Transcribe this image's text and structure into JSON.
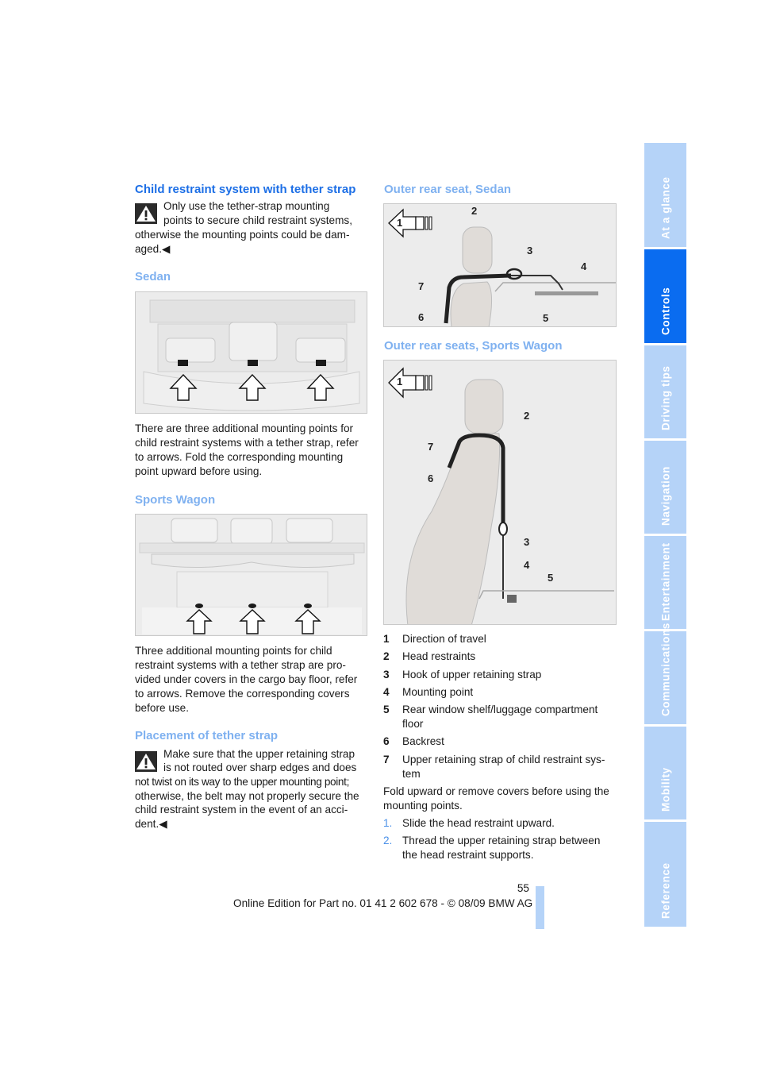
{
  "left_column": {
    "title": "Child restraint system with tether strap",
    "warning1_line1": "Only use the tether-strap mounting",
    "warning1_line2": "points to secure child restraint systems,",
    "warning1_line3": "otherwise the mounting points could be dam-",
    "warning1_line4": "aged.◀",
    "sedan_heading": "Sedan",
    "sedan_text": [
      "There are three additional mounting points for",
      "child restraint systems with a tether strap, refer",
      "to arrows. Fold the corresponding mounting",
      "point upward before using."
    ],
    "wagon_heading": "Sports Wagon",
    "wagon_text": [
      "Three additional mounting points for child",
      "restraint systems with a tether strap are pro-",
      "vided under covers in the cargo bay floor, refer",
      "to arrows. Remove the corresponding covers",
      "before use."
    ],
    "placement_heading": "Placement of tether strap",
    "warning2_line1": "Make sure that the upper retaining strap",
    "warning2_line2": "is not routed over sharp edges and does",
    "warning2_line3": "not twist on its way to the upper mounting point;",
    "warning2_line4": "otherwise, the belt may not properly secure the",
    "warning2_line5": "child restraint system in the event of an acci-",
    "warning2_line6": "dent.◀"
  },
  "right_column": {
    "sedan_seat_heading": "Outer rear seat, Sedan",
    "wagon_seat_heading": "Outer rear seats, Sports Wagon",
    "callouts": [
      "1",
      "2",
      "3",
      "4",
      "5",
      "6",
      "7"
    ],
    "legend": [
      {
        "num": "1",
        "lines": [
          "Direction of travel"
        ]
      },
      {
        "num": "2",
        "lines": [
          "Head restraints"
        ]
      },
      {
        "num": "3",
        "lines": [
          "Hook of upper retaining strap"
        ]
      },
      {
        "num": "4",
        "lines": [
          "Mounting point"
        ]
      },
      {
        "num": "5",
        "lines": [
          "Rear window shelf/luggage compartment",
          "floor"
        ]
      },
      {
        "num": "6",
        "lines": [
          "Backrest"
        ]
      },
      {
        "num": "7",
        "lines": [
          "Upper retaining strap of child restraint sys-",
          "tem"
        ]
      }
    ],
    "fold_text": [
      "Fold upward or remove covers before using the",
      "mounting points."
    ],
    "steps": [
      {
        "num": "1.",
        "lines": [
          "Slide the head restraint upward."
        ]
      },
      {
        "num": "2.",
        "lines": [
          "Thread the upper retaining strap between",
          "the head restraint supports."
        ]
      }
    ]
  },
  "footer": {
    "page_number": "55",
    "edition": "Online Edition for Part no. 01 41 2 602 678 - © 08/09 BMW AG"
  },
  "side_tabs": [
    {
      "label": "At a glance",
      "active": false
    },
    {
      "label": "Controls",
      "active": true
    },
    {
      "label": "Driving tips",
      "active": false
    },
    {
      "label": "Navigation",
      "active": false
    },
    {
      "label": "Entertainment",
      "active": false
    },
    {
      "label": "Communications",
      "active": false
    },
    {
      "label": "Mobility",
      "active": false
    },
    {
      "label": "Reference",
      "active": false
    }
  ],
  "colors": {
    "heading": "#1d6fe6",
    "subheading": "#7fb1f0",
    "tab": "#b5d3f8",
    "tab_active": "#0a6cf0"
  }
}
